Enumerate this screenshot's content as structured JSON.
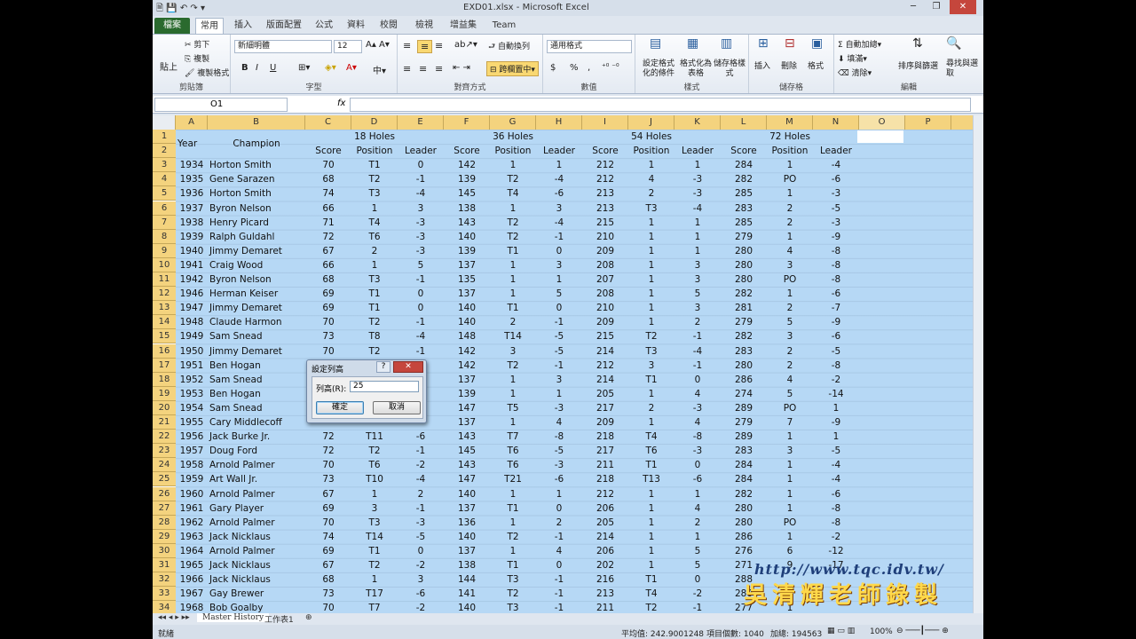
{
  "window": {
    "title": "EXD01.xlsx - Microsoft Excel",
    "minimize": "─",
    "restore": "❐",
    "close": "✕"
  },
  "tabs": [
    "檔案",
    "常用",
    "插入",
    "版面配置",
    "公式",
    "資料",
    "校閱",
    "檢視",
    "增益集",
    "Team"
  ],
  "ribbon": {
    "clipboard": {
      "cut": "剪下",
      "copy": "複製",
      "format_painter": "複製格式",
      "paste": "貼上",
      "label": "剪貼簿"
    },
    "font": {
      "name": "新細明體",
      "size": "12",
      "label": "字型",
      "bold": "B",
      "italic": "I",
      "underline": "U"
    },
    "alignment": {
      "wrap": "自動換列",
      "merge": "跨欄置中",
      "label": "對齊方式"
    },
    "number": {
      "format": "通用格式",
      "currency": "$",
      "percent": "%",
      "comma": ",",
      "label": "數值"
    },
    "styles": {
      "conditional": "設定格式化的條件",
      "table": "格式化為表格",
      "cell": "儲存格樣式",
      "label": "樣式"
    },
    "cells": {
      "insert": "插入",
      "delete": "刪除",
      "format": "格式",
      "label": "儲存格"
    },
    "editing": {
      "autosum": "自動加總",
      "fill": "填滿",
      "clear": "清除",
      "sort": "排序與篩選",
      "find": "尋找與選取",
      "label": "編輯"
    }
  },
  "formula_bar": {
    "name_box": "O1",
    "fx": "fx",
    "value": ""
  },
  "columns": [
    "A",
    "B",
    "C",
    "D",
    "E",
    "F",
    "G",
    "H",
    "I",
    "J",
    "K",
    "L",
    "M",
    "N",
    "O",
    "P"
  ],
  "headers": {
    "year": "Year",
    "champion": "Champion",
    "h18": "18 Holes",
    "h36": "36 Holes",
    "h54": "54 Holes",
    "h72": "72 Holes",
    "score": "Score",
    "position": "Position",
    "leader": "Leader"
  },
  "rows": [
    [
      "1934",
      "Horton Smith",
      "70",
      "T1",
      "0",
      "142",
      "1",
      "1",
      "212",
      "1",
      "1",
      "284",
      "1",
      "-4"
    ],
    [
      "1935",
      "Gene Sarazen",
      "68",
      "T2",
      "-1",
      "139",
      "T2",
      "-4",
      "212",
      "4",
      "-3",
      "282",
      "PO",
      "-6"
    ],
    [
      "1936",
      "Horton Smith",
      "74",
      "T3",
      "-4",
      "145",
      "T4",
      "-6",
      "213",
      "2",
      "-3",
      "285",
      "1",
      "-3"
    ],
    [
      "1937",
      "Byron Nelson",
      "66",
      "1",
      "3",
      "138",
      "1",
      "3",
      "213",
      "T3",
      "-4",
      "283",
      "2",
      "-5"
    ],
    [
      "1938",
      "Henry Picard",
      "71",
      "T4",
      "-3",
      "143",
      "T2",
      "-4",
      "215",
      "1",
      "1",
      "285",
      "2",
      "-3"
    ],
    [
      "1939",
      "Ralph Guldahl",
      "72",
      "T6",
      "-3",
      "140",
      "T2",
      "-1",
      "210",
      "1",
      "1",
      "279",
      "1",
      "-9"
    ],
    [
      "1940",
      "Jimmy Demaret",
      "67",
      "2",
      "-3",
      "139",
      "T1",
      "0",
      "209",
      "1",
      "1",
      "280",
      "4",
      "-8"
    ],
    [
      "1941",
      "Craig Wood",
      "66",
      "1",
      "5",
      "137",
      "1",
      "3",
      "208",
      "1",
      "3",
      "280",
      "3",
      "-8"
    ],
    [
      "1942",
      "Byron Nelson",
      "68",
      "T3",
      "-1",
      "135",
      "1",
      "1",
      "207",
      "1",
      "3",
      "280",
      "PO",
      "-8"
    ],
    [
      "1946",
      "Herman Keiser",
      "69",
      "T1",
      "0",
      "137",
      "1",
      "5",
      "208",
      "1",
      "5",
      "282",
      "1",
      "-6"
    ],
    [
      "1947",
      "Jimmy Demaret",
      "69",
      "T1",
      "0",
      "140",
      "T1",
      "0",
      "210",
      "1",
      "3",
      "281",
      "2",
      "-7"
    ],
    [
      "1948",
      "Claude Harmon",
      "70",
      "T2",
      "-1",
      "140",
      "2",
      "-1",
      "209",
      "1",
      "2",
      "279",
      "5",
      "-9"
    ],
    [
      "1949",
      "Sam Snead",
      "73",
      "T8",
      "-4",
      "148",
      "T14",
      "-5",
      "215",
      "T2",
      "-1",
      "282",
      "3",
      "-6"
    ],
    [
      "1950",
      "Jimmy Demaret",
      "70",
      "T2",
      "-1",
      "142",
      "3",
      "-5",
      "214",
      "T3",
      "-4",
      "283",
      "2",
      "-5"
    ],
    [
      "1951",
      "Ben Hogan",
      "",
      "",
      "",
      "142",
      "T2",
      "-1",
      "212",
      "3",
      "-1",
      "280",
      "2",
      "-8"
    ],
    [
      "1952",
      "Sam Snead",
      "",
      "",
      "",
      "137",
      "1",
      "3",
      "214",
      "T1",
      "0",
      "286",
      "4",
      "-2"
    ],
    [
      "1953",
      "Ben Hogan",
      "",
      "",
      "",
      "139",
      "1",
      "1",
      "205",
      "1",
      "4",
      "274",
      "5",
      "-14"
    ],
    [
      "1954",
      "Sam Snead",
      "",
      "",
      "",
      "147",
      "T5",
      "-3",
      "217",
      "2",
      "-3",
      "289",
      "PO",
      "1"
    ],
    [
      "1955",
      "Cary Middlecoff",
      "",
      "",
      "",
      "137",
      "1",
      "4",
      "209",
      "1",
      "4",
      "279",
      "7",
      "-9"
    ],
    [
      "1956",
      "Jack Burke Jr.",
      "72",
      "T11",
      "-6",
      "143",
      "T7",
      "-8",
      "218",
      "T4",
      "-8",
      "289",
      "1",
      "1"
    ],
    [
      "1957",
      "Doug Ford",
      "72",
      "T2",
      "-1",
      "145",
      "T6",
      "-5",
      "217",
      "T6",
      "-3",
      "283",
      "3",
      "-5"
    ],
    [
      "1958",
      "Arnold Palmer",
      "70",
      "T6",
      "-2",
      "143",
      "T6",
      "-3",
      "211",
      "T1",
      "0",
      "284",
      "1",
      "-4"
    ],
    [
      "1959",
      "Art Wall Jr.",
      "73",
      "T10",
      "-4",
      "147",
      "T21",
      "-6",
      "218",
      "T13",
      "-6",
      "284",
      "1",
      "-4"
    ],
    [
      "1960",
      "Arnold Palmer",
      "67",
      "1",
      "2",
      "140",
      "1",
      "1",
      "212",
      "1",
      "1",
      "282",
      "1",
      "-6"
    ],
    [
      "1961",
      "Gary Player",
      "69",
      "3",
      "-1",
      "137",
      "T1",
      "0",
      "206",
      "1",
      "4",
      "280",
      "1",
      "-8"
    ],
    [
      "1962",
      "Arnold Palmer",
      "70",
      "T3",
      "-3",
      "136",
      "1",
      "2",
      "205",
      "1",
      "2",
      "280",
      "PO",
      "-8"
    ],
    [
      "1963",
      "Jack Nicklaus",
      "74",
      "T14",
      "-5",
      "140",
      "T2",
      "-1",
      "214",
      "1",
      "1",
      "286",
      "1",
      "-2"
    ],
    [
      "1964",
      "Arnold Palmer",
      "69",
      "T1",
      "0",
      "137",
      "1",
      "4",
      "206",
      "1",
      "5",
      "276",
      "6",
      "-12"
    ],
    [
      "1965",
      "Jack Nicklaus",
      "67",
      "T2",
      "-2",
      "138",
      "T1",
      "0",
      "202",
      "1",
      "5",
      "271",
      "9",
      "-17"
    ],
    [
      "1966",
      "Jack Nicklaus",
      "68",
      "1",
      "3",
      "144",
      "T3",
      "-1",
      "216",
      "T1",
      "0",
      "288",
      "",
      ""
    ],
    [
      "1967",
      "Gay Brewer",
      "73",
      "T17",
      "-6",
      "141",
      "T2",
      "-1",
      "213",
      "T4",
      "-2",
      "280",
      "",
      ""
    ],
    [
      "1968",
      "Bob Goalby",
      "70",
      "T7",
      "-2",
      "140",
      "T3",
      "-1",
      "211",
      "T2",
      "-1",
      "277",
      "1",
      ""
    ]
  ],
  "dialog": {
    "title": "設定列高",
    "help": "?",
    "close": "✕",
    "label": "列高(R):",
    "value": "25",
    "ok": "確定",
    "cancel": "取消"
  },
  "sheet_tabs": {
    "active": "Master History",
    "other": "工作表1"
  },
  "status": {
    "ready": "就緒",
    "average": "平均值: 242.9001248",
    "count": "項目個數: 1040",
    "sum": "加總: 194563",
    "zoom": "100%"
  },
  "watermark": {
    "url": "http://www.tqc.idv.tw/",
    "author": "吳清輝老師錄製"
  },
  "colors": {
    "selection": "#b6d8f5",
    "header_selected": "#f4d37e",
    "file_tab": "#2a6a2e"
  }
}
